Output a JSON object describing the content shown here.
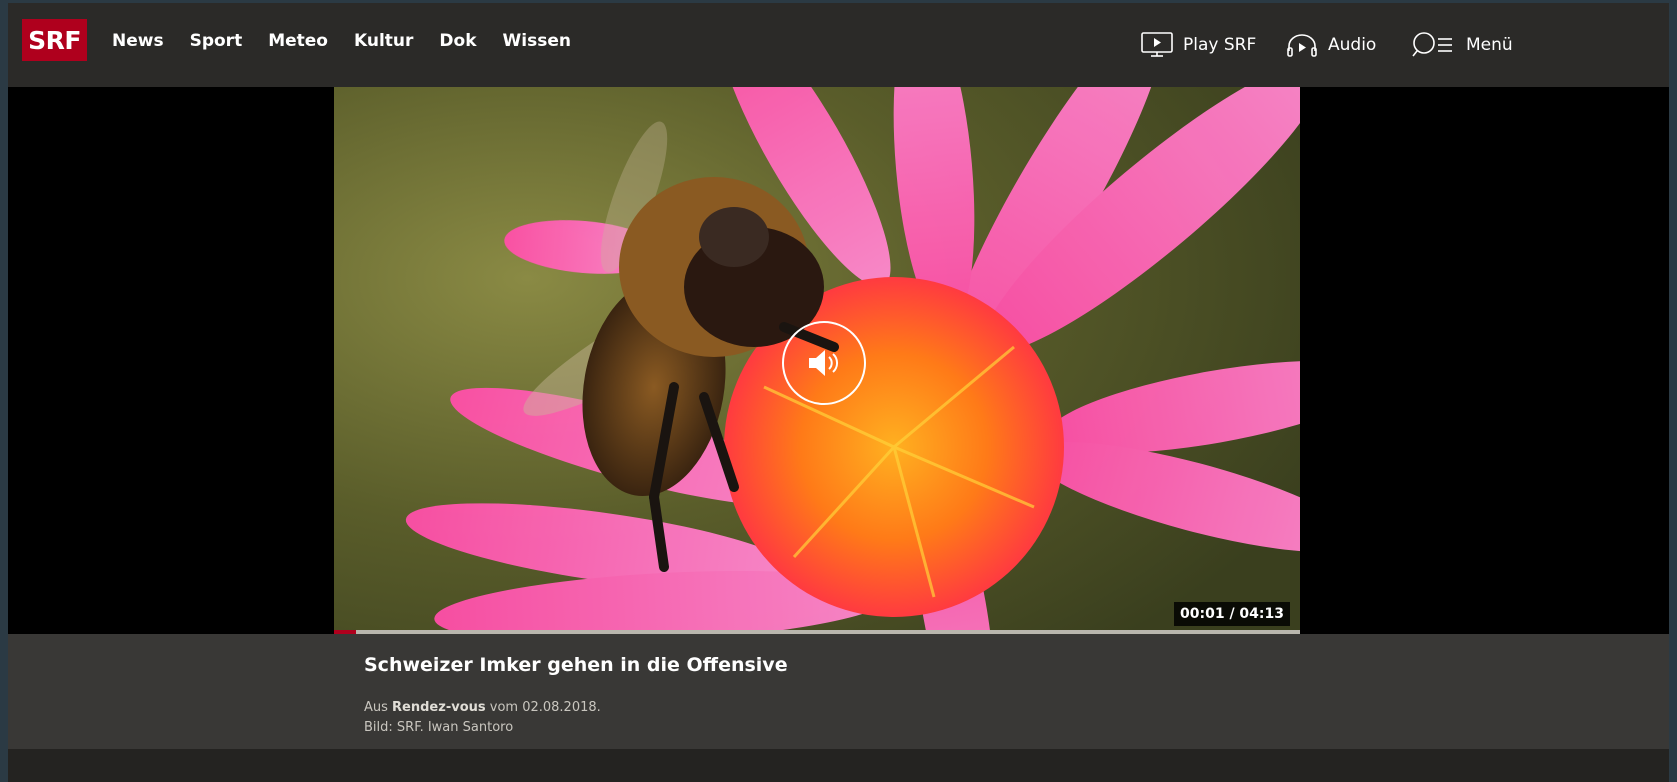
{
  "header": {
    "logo": "SRF",
    "nav": [
      "News",
      "Sport",
      "Meteo",
      "Kultur",
      "Dok",
      "Wissen"
    ],
    "right": {
      "play": {
        "label": "Play SRF",
        "icon": "tv-play-icon"
      },
      "audio": {
        "label": "Audio",
        "icon": "headphones-play-icon"
      },
      "menu": {
        "label": "Menü",
        "icon": "search-menu-icon"
      }
    }
  },
  "video": {
    "description": "Bee on pink flower",
    "sound_icon": "speaker-icon",
    "timecode": "00:01 / 04:13",
    "progress_fraction": 0.023
  },
  "caption": {
    "title": "Schweizer Imker gehen in die Offensive",
    "source_prefix": "Aus",
    "source_show": "Rendez-vous",
    "source_suffix": "vom 02.08.2018.",
    "credit": "Bild: SRF. Iwan Santoro"
  },
  "colors": {
    "brand": "#af001d",
    "header_bg": "#2b2a28",
    "caption_bg": "#393836"
  }
}
